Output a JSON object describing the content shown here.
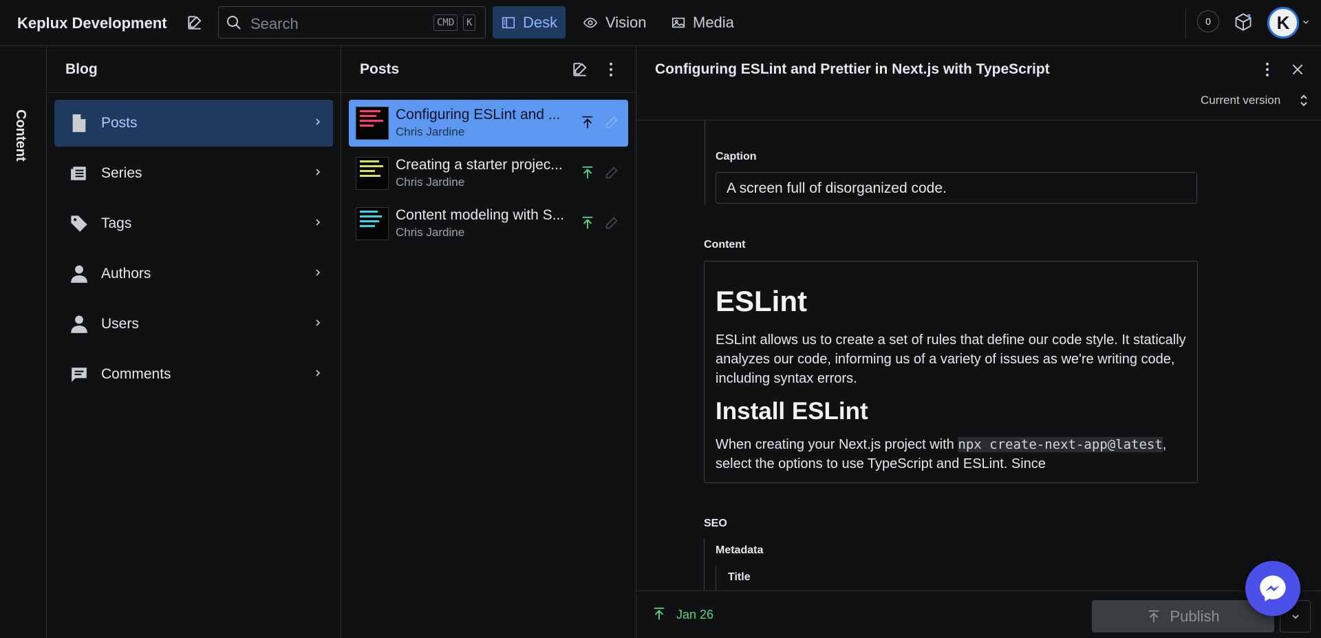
{
  "app": {
    "title": "Keplux Development"
  },
  "search": {
    "placeholder": "Search",
    "shortcut_cmd": "CMD",
    "shortcut_key": "K"
  },
  "nav": {
    "desk": "Desk",
    "vision": "Vision",
    "media": "Media"
  },
  "notifications": {
    "count": "0"
  },
  "user": {
    "initial": "K"
  },
  "rail": {
    "label": "Content"
  },
  "blog": {
    "title": "Blog",
    "items": [
      {
        "label": "Posts",
        "icon": "document-icon",
        "selected": true
      },
      {
        "label": "Series",
        "icon": "list-icon"
      },
      {
        "label": "Tags",
        "icon": "tag-icon"
      },
      {
        "label": "Authors",
        "icon": "person-icon"
      },
      {
        "label": "Users",
        "icon": "person-icon"
      },
      {
        "label": "Comments",
        "icon": "comment-icon"
      }
    ]
  },
  "posts": {
    "title": "Posts",
    "items": [
      {
        "title": "Configuring ESLint and ...",
        "author": "Chris Jardine",
        "selected": true
      },
      {
        "title": "Creating a starter projec...",
        "author": "Chris Jardine"
      },
      {
        "title": "Content modeling with S...",
        "author": "Chris Jardine"
      }
    ]
  },
  "document": {
    "title": "Configuring ESLint and Prettier in Next.js with TypeScript",
    "version": "Current version",
    "caption_label": "Caption",
    "caption_value": "A screen full of disorganized code.",
    "content_label": "Content",
    "content": {
      "h1": "ESLint",
      "p1": "ESLint allows us to create a set of rules that define our code style. It statically analyzes our code, informing us of a variety of issues as we're writing code, including syntax errors.",
      "h2": "Install ESLint",
      "p2_before": "When creating your Next.js project with ",
      "p2_code1": "npx create-next-app@latest",
      "p2_after": ", select the options to use TypeScript and  ESLint. Since"
    },
    "seo_label": "SEO",
    "metadata_label": "Metadata",
    "title_label": "Title"
  },
  "footer": {
    "date": "Jan 26",
    "publish": "Publish"
  },
  "colors": {
    "accent": "#5c98f2",
    "selected_nav": "#1e3a5f",
    "published_green": "#5fd38a",
    "messenger": "#4a50e8"
  }
}
